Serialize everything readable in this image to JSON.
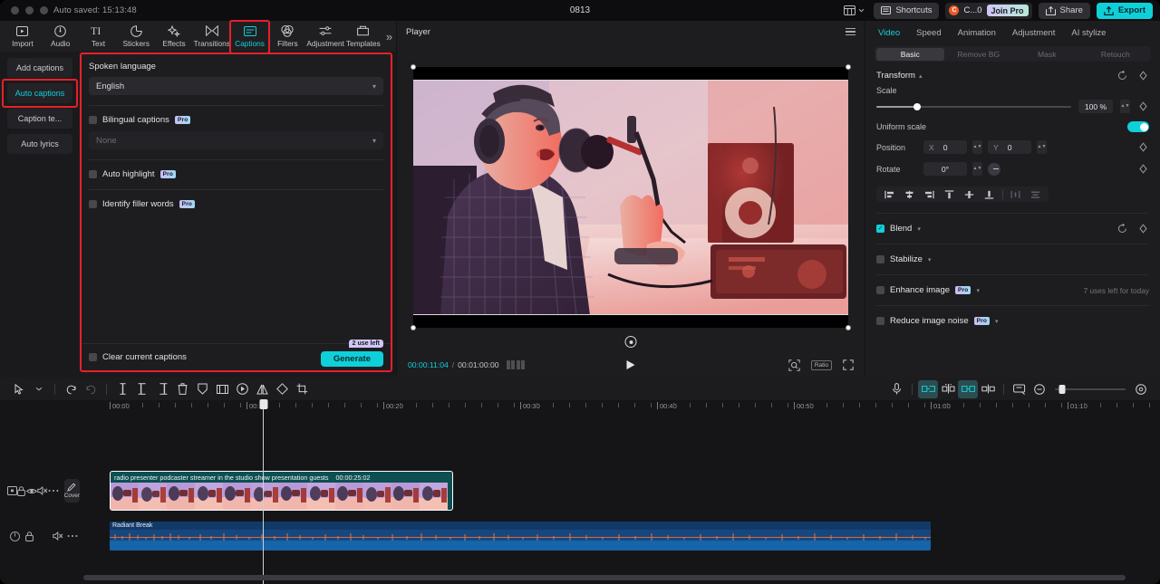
{
  "titlebar": {
    "autosave": "Auto saved: 15:13:48",
    "project_title": "0813",
    "layout_icon": "layout-icon",
    "shortcuts_label": "Shortcuts",
    "credit_label": "C...0",
    "credit_initial": "C",
    "join_pro_label": "Join Pro",
    "share_label": "Share",
    "export_label": "Export"
  },
  "toolbar": {
    "items": [
      {
        "label": "Import",
        "icon": "import-icon"
      },
      {
        "label": "Audio",
        "icon": "audio-icon"
      },
      {
        "label": "Text",
        "icon": "text-icon"
      },
      {
        "label": "Stickers",
        "icon": "stickers-icon"
      },
      {
        "label": "Effects",
        "icon": "effects-icon"
      },
      {
        "label": "Transitions",
        "icon": "transitions-icon"
      },
      {
        "label": "Captions",
        "icon": "captions-icon"
      },
      {
        "label": "Filters",
        "icon": "filters-icon"
      },
      {
        "label": "Adjustment",
        "icon": "adjustment-icon"
      },
      {
        "label": "Templates",
        "icon": "templates-icon"
      }
    ],
    "more_icon": "chevron-double-right-icon"
  },
  "captions_nav": {
    "items": [
      {
        "label": "Add captions"
      },
      {
        "label": "Auto captions"
      },
      {
        "label": "Caption te..."
      },
      {
        "label": "Auto lyrics"
      }
    ]
  },
  "captions_panel": {
    "spoken_language_label": "Spoken language",
    "spoken_language_value": "English",
    "bilingual_label": "Bilingual captions",
    "bilingual_value": "None",
    "auto_highlight_label": "Auto highlight",
    "identify_filler_label": "Identify filler words",
    "pro_badge": "Pro",
    "clear_label": "Clear current captions",
    "uses_left": "2 use left",
    "generate_label": "Generate"
  },
  "player": {
    "title": "Player",
    "menu_icon": "hamburger-icon",
    "current_time": "00:00:11:04",
    "separator": "/",
    "total_time": "00:01:00:00",
    "frames_icon": "frames-icon",
    "play_icon": "play-icon",
    "zoom_icon": "zoom-detect-icon",
    "ratio_label": "Ratio",
    "fullscreen_icon": "fullscreen-icon"
  },
  "inspector": {
    "tabs": [
      {
        "label": "Video"
      },
      {
        "label": "Speed"
      },
      {
        "label": "Animation"
      },
      {
        "label": "Adjustment"
      },
      {
        "label": "AI stylize"
      }
    ],
    "segments": [
      {
        "label": "Basic"
      },
      {
        "label": "Remove BG"
      },
      {
        "label": "Mask"
      },
      {
        "label": "Retouch"
      }
    ],
    "transform_label": "Transform",
    "scale_label": "Scale",
    "scale_value": "100 %",
    "uniform_scale_label": "Uniform scale",
    "position_label": "Position",
    "position_x_axis": "X",
    "position_x_value": "0",
    "position_y_axis": "Y",
    "position_y_value": "0",
    "rotate_label": "Rotate",
    "rotate_value": "0°",
    "reset_icon": "reset-icon",
    "keyframe_icon": "keyframe-diamond-icon",
    "align_icons": [
      "align-left-icon",
      "align-center-h-icon",
      "align-right-icon",
      "align-top-icon",
      "align-center-v-icon",
      "align-bottom-icon",
      "distribute-h-icon",
      "distribute-v-icon"
    ],
    "options": [
      {
        "label": "Blend",
        "checked": true,
        "pro": false,
        "note": ""
      },
      {
        "label": "Stabilize",
        "checked": false,
        "pro": false,
        "note": ""
      },
      {
        "label": "Enhance image",
        "checked": false,
        "pro": true,
        "note": "7 uses left for today"
      },
      {
        "label": "Reduce image noise",
        "checked": false,
        "pro": true,
        "note": ""
      }
    ],
    "pro_badge": "Pro"
  },
  "timeline": {
    "tools": [
      {
        "icon": "select-arrow-icon"
      },
      {
        "icon": "chevron-down-icon"
      },
      {
        "icon": "undo-icon"
      },
      {
        "icon": "redo-icon"
      },
      {
        "icon": "split-icon"
      },
      {
        "icon": "trim-left-icon"
      },
      {
        "icon": "trim-right-icon"
      },
      {
        "icon": "delete-icon"
      },
      {
        "icon": "freeze-icon"
      },
      {
        "icon": "crop-frame-icon"
      },
      {
        "icon": "speed-icon"
      },
      {
        "icon": "mirror-icon"
      },
      {
        "icon": "rotate-icon"
      },
      {
        "icon": "crop-icon"
      }
    ],
    "right_tools": [
      {
        "icon": "mic-icon"
      },
      {
        "icon": "link-clips-icon"
      },
      {
        "icon": "auto-split-icon"
      },
      {
        "icon": "linked-selection-icon"
      },
      {
        "icon": "split-marker-icon"
      },
      {
        "icon": "proxy-icon"
      },
      {
        "icon": "zoom-out-icon"
      },
      {
        "icon": "zoom-fit-icon"
      }
    ],
    "ruler_labels": [
      "00:00",
      "00:10",
      "00:20",
      "00:30",
      "00:40",
      "00:50",
      "01:00",
      "01:10"
    ],
    "video_track": {
      "head_icons": [
        "thumbnail-toggle-icon",
        "lock-icon",
        "eye-icon",
        "mute-icon",
        "more-icon"
      ],
      "cover_label": "Cover",
      "cover_icon": "pen-icon",
      "clip_name": "radio presenter podcaster streamer in the studio show presentation guests",
      "clip_duration": "00:00:25:02"
    },
    "audio_track": {
      "head_icons": [
        "audio-meter-icon",
        "lock-icon",
        "mute-icon",
        "more-icon"
      ],
      "clip_name": "Radiant Break"
    }
  },
  "colors": {
    "accent": "#0fd0d8",
    "highlight_red": "#e8202a",
    "video_clip": "#0e4f52",
    "audio_clip": "#16477e",
    "pro_badge": "#c7bdf2"
  }
}
